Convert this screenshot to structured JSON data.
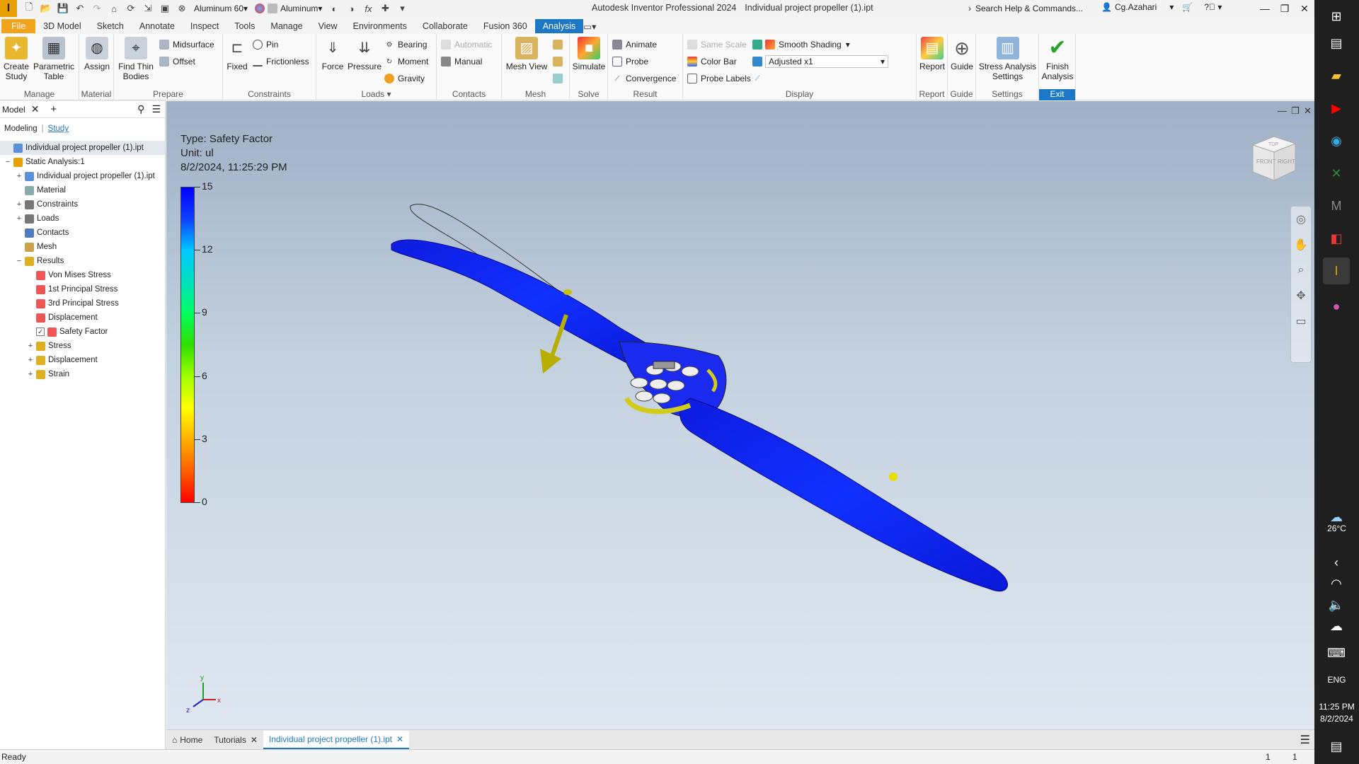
{
  "titlebar": {
    "material_appearance": "Aluminum 60",
    "material": "Aluminum",
    "app_title": "Autodesk Inventor Professional 2024",
    "doc_title": "Individual project propeller (1).ipt",
    "search_placeholder": "Search Help & Commands...",
    "user": "Cg.Azahari"
  },
  "menu_tabs": [
    "File",
    "3D Model",
    "Sketch",
    "Annotate",
    "Inspect",
    "Tools",
    "Manage",
    "View",
    "Environments",
    "Collaborate",
    "Fusion 360",
    "Analysis"
  ],
  "ribbon": {
    "manage": {
      "label": "Manage",
      "create_study": "Create\nStudy",
      "parametric_table": "Parametric\nTable"
    },
    "material": {
      "label": "Material",
      "assign": "Assign"
    },
    "prepare": {
      "label": "Prepare",
      "find_thin_bodies": "Find Thin\nBodies",
      "midsurface": "Midsurface",
      "offset": "Offset"
    },
    "constraints": {
      "label": "Constraints",
      "fixed": "Fixed",
      "pin": "Pin",
      "frictionless": "Frictionless"
    },
    "loads": {
      "label": "Loads",
      "force": "Force",
      "pressure": "Pressure",
      "bearing": "Bearing",
      "moment": "Moment",
      "gravity": "Gravity"
    },
    "contacts": {
      "label": "Contacts",
      "automatic": "Automatic",
      "manual": "Manual"
    },
    "mesh": {
      "label": "Mesh",
      "mesh_view": "Mesh View"
    },
    "solve": {
      "label": "Solve",
      "simulate": "Simulate"
    },
    "result": {
      "label": "Result",
      "animate": "Animate",
      "probe": "Probe",
      "convergence": "Convergence"
    },
    "display": {
      "label": "Display",
      "same_scale": "Same Scale",
      "color_bar": "Color Bar",
      "probe_labels": "Probe Labels",
      "smooth_shading": "Smooth Shading",
      "adjusted": "Adjusted x1"
    },
    "report": {
      "label": "Report",
      "report": "Report"
    },
    "guide": {
      "label": "Guide",
      "guide": "Guide"
    },
    "settings": {
      "label": "Settings",
      "stress_analysis_settings": "Stress Analysis\nSettings"
    },
    "exit": {
      "label": "Exit",
      "finish_analysis": "Finish\nAnalysis"
    }
  },
  "browser": {
    "tab": "Model",
    "subtabs": [
      "Modeling",
      "Study"
    ],
    "tree": [
      {
        "label": "Individual project propeller (1).ipt",
        "level": 0,
        "exp": "",
        "color": "#5b8fd6",
        "selected": true
      },
      {
        "label": "Static Analysis:1",
        "level": 0,
        "exp": "−",
        "color": "#e8a100"
      },
      {
        "label": "Individual project propeller (1).ipt",
        "level": 1,
        "exp": "+",
        "color": "#5b8fd6"
      },
      {
        "label": "Material",
        "level": 1,
        "exp": "",
        "color": "#8aa"
      },
      {
        "label": "Constraints",
        "level": 1,
        "exp": "+",
        "color": "#777"
      },
      {
        "label": "Loads",
        "level": 1,
        "exp": "+",
        "color": "#777"
      },
      {
        "label": "Contacts",
        "level": 1,
        "exp": "",
        "color": "#4a7bbf"
      },
      {
        "label": "Mesh",
        "level": 1,
        "exp": "",
        "color": "#c9a24a"
      },
      {
        "label": "Results",
        "level": 1,
        "exp": "−",
        "color": "#e0b020"
      },
      {
        "label": "Von Mises Stress",
        "level": 2,
        "exp": "",
        "color": "#e55"
      },
      {
        "label": "1st Principal Stress",
        "level": 2,
        "exp": "",
        "color": "#e55"
      },
      {
        "label": "3rd Principal Stress",
        "level": 2,
        "exp": "",
        "color": "#e55"
      },
      {
        "label": "Displacement",
        "level": 2,
        "exp": "",
        "color": "#e55"
      },
      {
        "label": "Safety Factor",
        "level": 2,
        "exp": "",
        "color": "#e55",
        "checked": true
      },
      {
        "label": "Stress",
        "level": 2,
        "exp": "+",
        "color": "#e0b020"
      },
      {
        "label": "Displacement",
        "level": 2,
        "exp": "+",
        "color": "#e0b020"
      },
      {
        "label": "Strain",
        "level": 2,
        "exp": "+",
        "color": "#e0b020"
      }
    ]
  },
  "viewport": {
    "type": "Type: Safety Factor",
    "unit": "Unit: ul",
    "timestamp": "8/2/2024, 11:25:29 PM",
    "legend": [
      "15",
      "12",
      "9",
      "6",
      "3",
      "0"
    ],
    "viewcube_front": "FRONT",
    "viewcube_right": "RIGHT",
    "viewcube_top": "TOP"
  },
  "doc_tabs": {
    "home": "Home",
    "tutorials": "Tutorials",
    "active": "Individual project propeller (1).ipt"
  },
  "status": {
    "text": "Ready",
    "n1": "1",
    "n2": "1"
  },
  "taskbar": {
    "temp": "26°C",
    "lang": "ENG",
    "time": "11:25 PM",
    "date": "8/2/2024"
  }
}
